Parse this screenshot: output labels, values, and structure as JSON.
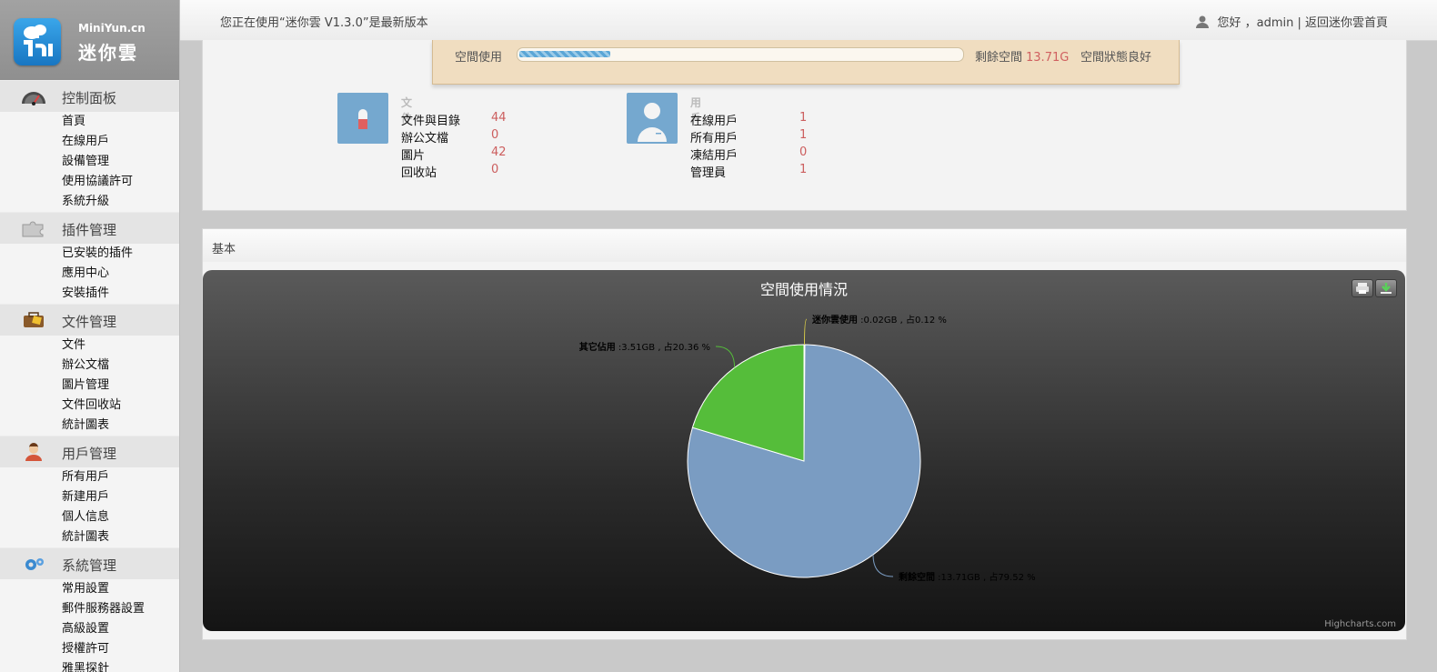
{
  "sidebar": {
    "logo_en": "MiniYun.cn",
    "logo_cn": "迷你雲",
    "groups": [
      {
        "title": "控制面板",
        "icon": "dashboard-gauge-icon",
        "items": [
          "首頁",
          "在線用戶",
          "設備管理",
          "使用協議許可",
          "系統升級"
        ]
      },
      {
        "title": "插件管理",
        "icon": "puzzle-icon",
        "items": [
          "已安裝的插件",
          "應用中心",
          "安裝插件"
        ]
      },
      {
        "title": "文件管理",
        "icon": "folder-case-icon",
        "items": [
          "文件",
          "辦公文檔",
          "圖片管理",
          "文件回收站",
          "統計圖表"
        ]
      },
      {
        "title": "用戶管理",
        "icon": "user-avatar-icon",
        "items": [
          "所有用戶",
          "新建用戶",
          "個人信息",
          "統計圖表"
        ]
      },
      {
        "title": "系統管理",
        "icon": "gears-icon",
        "items": [
          "常用設置",
          "郵件服務器設置",
          "高級設置",
          "授權許可",
          "雅黑探針"
        ]
      }
    ]
  },
  "topbar": {
    "version_msg": "您正在使用“迷你雲 V1.3.0”是最新版本",
    "greeting": "您好 ，admin | 返回迷你雲首頁"
  },
  "space": {
    "label": "空間使用",
    "used_fraction": 0.2048,
    "remaining_label": "剩餘空間",
    "remaining_value": "13.71G",
    "status": "空間狀態良好"
  },
  "files_card": {
    "title": "文件",
    "rows": [
      {
        "label": "文件與目錄",
        "value": "44"
      },
      {
        "label": "辦公文檔",
        "value": "0"
      },
      {
        "label": "圖片",
        "value": "42"
      },
      {
        "label": "回收站",
        "value": "0"
      }
    ]
  },
  "users_card": {
    "title": "用戶",
    "rows": [
      {
        "label": "在線用戶",
        "value": "1"
      },
      {
        "label": "所有用戶",
        "value": "1"
      },
      {
        "label": "凍結用戶",
        "value": "0"
      },
      {
        "label": "管理員",
        "value": "1"
      }
    ]
  },
  "basic_panel": {
    "title": "基本"
  },
  "chart_data": {
    "type": "pie",
    "title": "空間使用情況",
    "credit": "Highcharts.com",
    "slices": [
      {
        "name": "迷你雲使用",
        "value": 0.12,
        "label_text": ":0.02GB , 占0.12 %",
        "color": "#d4c84a"
      },
      {
        "name": "剩餘空間",
        "value": 79.52,
        "label_text": ":13.71GB , 占79.52 %",
        "color": "#7a9cc2"
      },
      {
        "name": "其它佔用",
        "value": 20.36,
        "label_text": ":3.51GB , 占20.36 %",
        "color": "#55bd3a"
      }
    ]
  }
}
